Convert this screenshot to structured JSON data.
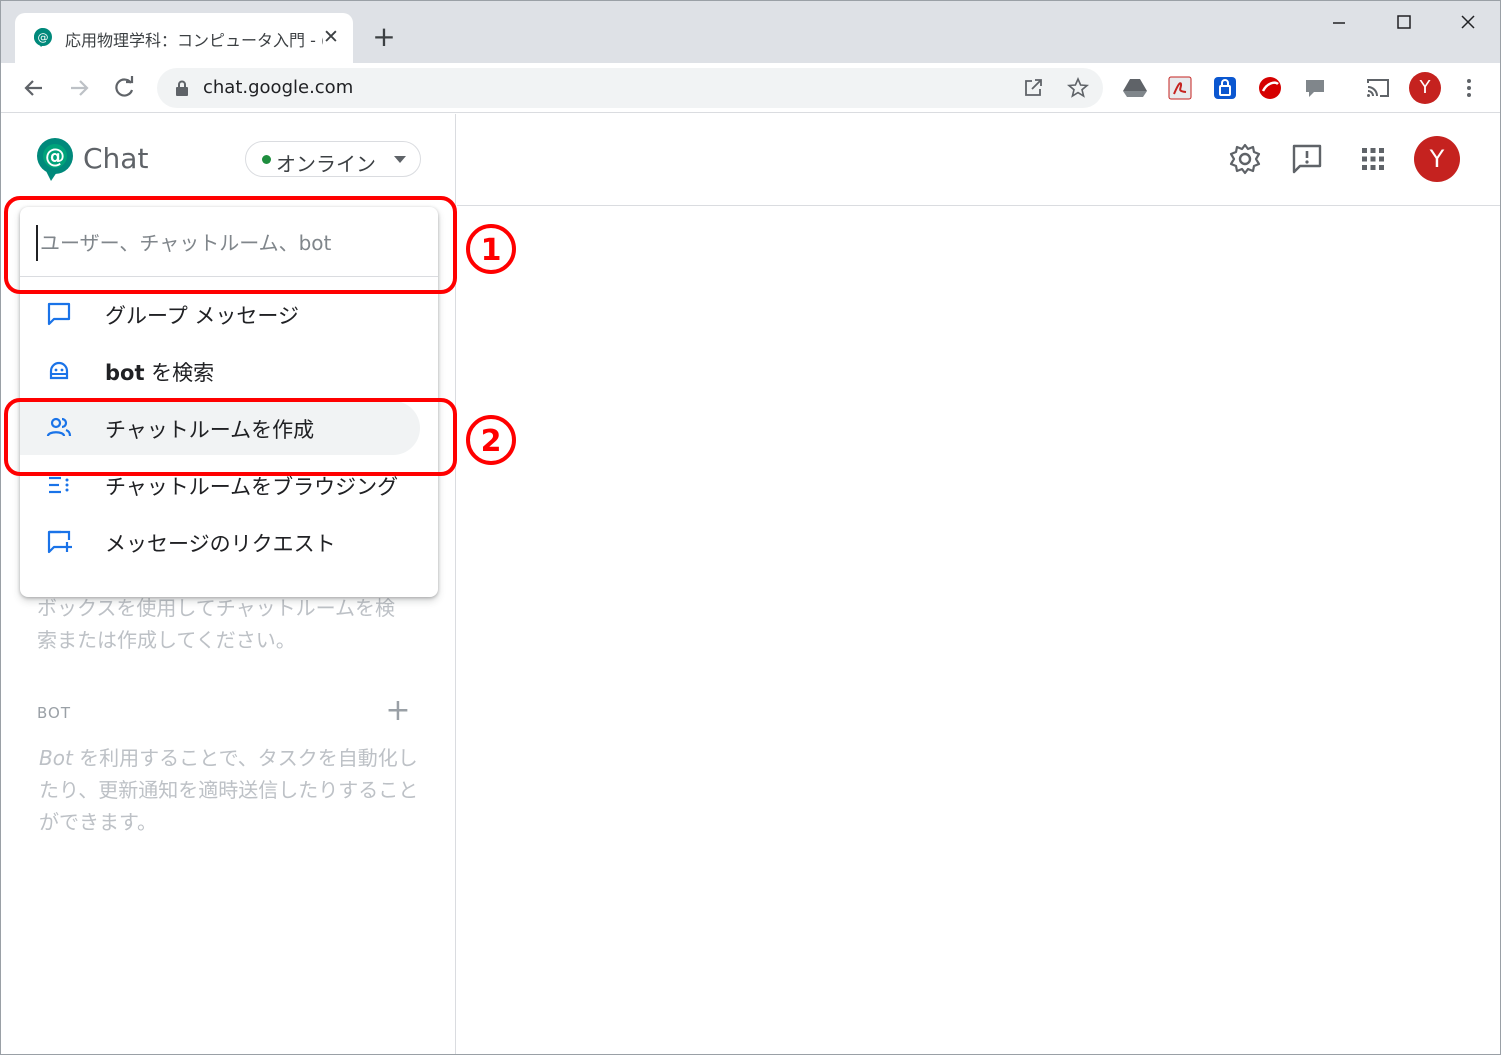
{
  "browser": {
    "tab_title": "応用物理学科：コンピュータ入門 - (",
    "tab_close": "✕",
    "new_tab": "+",
    "url": "chat.google.com",
    "profile_initial": "Y"
  },
  "app": {
    "name": "Chat",
    "status": "オンライン",
    "user_initial": "Y"
  },
  "dropdown": {
    "search_placeholder": "ユーザー、チャットルーム、bot",
    "items": [
      {
        "label": "グループ メッセージ",
        "icon": "chat-bubble-icon"
      },
      {
        "label_bold": "bot",
        "label": " を検索",
        "icon": "bot-icon"
      },
      {
        "label": "チャットルームを作成",
        "icon": "people-icon"
      },
      {
        "label": "チャットルームをブラウジング",
        "icon": "browse-list-icon"
      },
      {
        "label": "メッセージのリクエスト",
        "icon": "message-add-icon"
      }
    ]
  },
  "sidebar": {
    "rooms_hint_line1": "ボックスを使用してチャットルームを検",
    "rooms_hint_line2": "索または作成してください。",
    "bot_heading": "BOT",
    "bot_add": "+",
    "bot_desc_italic": "Bot",
    "bot_desc": " を利用することで、タスクを自動化したり、更新通知を適時送信したりすることができます。"
  },
  "annotations": {
    "one": "1",
    "two": "2",
    "color": "#ff0000"
  }
}
